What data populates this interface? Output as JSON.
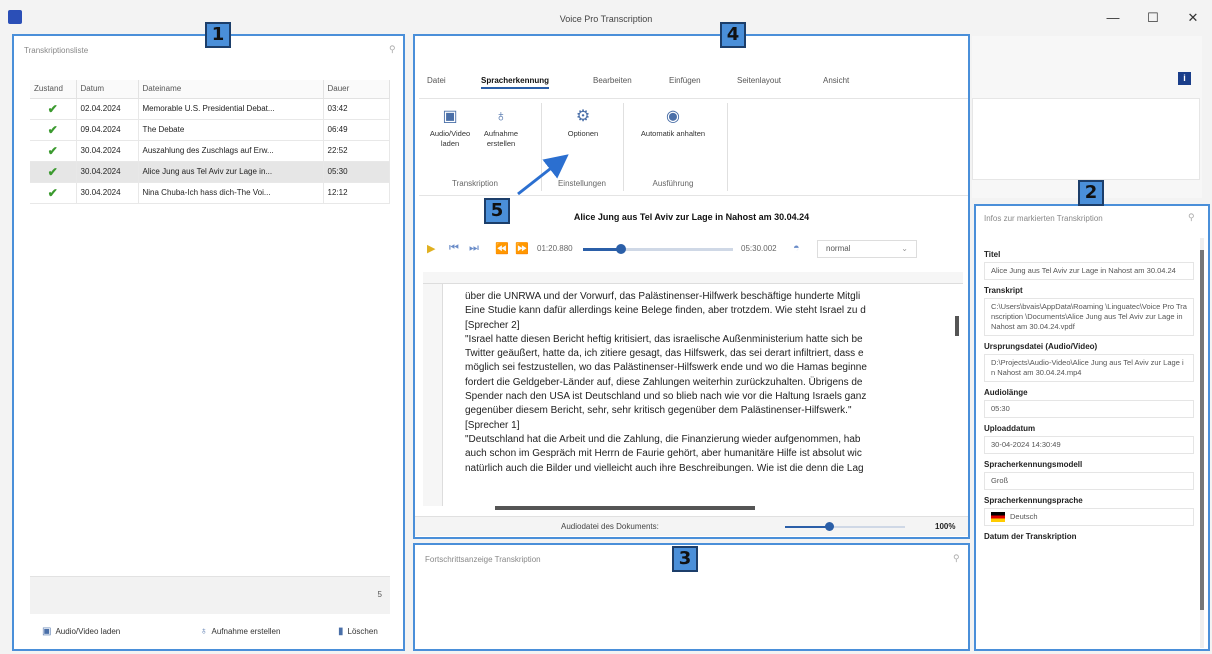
{
  "window": {
    "title": "Voice Pro Transcription",
    "minimize": "—",
    "maximize": "☐",
    "close": "✕"
  },
  "callouts": {
    "n1": "1",
    "n2": "2",
    "n3": "3",
    "n4": "4",
    "n5": "5"
  },
  "list_panel": {
    "title": "Transkriptionsliste",
    "columns": [
      "Zustand",
      "Datum",
      "Dateiname",
      "Dauer"
    ],
    "rows": [
      {
        "date": "02.04.2024",
        "name": "Memorable U.S. Presidential Debat...",
        "dur": "03:42"
      },
      {
        "date": "09.04.2024",
        "name": "The Debate",
        "dur": "06:49"
      },
      {
        "date": "30.04.2024",
        "name": "Auszahlung des Zuschlags auf Erw...",
        "dur": "22:52"
      },
      {
        "date": "30.04.2024",
        "name": "Alice Jung aus Tel Aviv zur Lage in...",
        "dur": "05:30"
      },
      {
        "date": "30.04.2024",
        "name": "Nina Chuba-Ich hass dich-The Voi...",
        "dur": "12:12"
      }
    ],
    "count": "5",
    "buttons": {
      "load": "Audio/Video laden",
      "record": "Aufnahme erstellen",
      "delete": "Löschen"
    }
  },
  "ribbon": {
    "tabs": [
      "Datei",
      "Spracherkennung",
      "Bearbeiten",
      "Einfügen",
      "Seitenlayout",
      "Ansicht"
    ],
    "buttons": {
      "load": "Audio/Video laden",
      "record": "Aufnahme erstellen",
      "options": "Optionen",
      "auto_stop": "Automatik anhalten"
    },
    "groups": {
      "transcription": "Transkription",
      "settings": "Einstellungen",
      "execution": "Ausführung"
    }
  },
  "player": {
    "title": "Alice Jung aus Tel Aviv zur Lage in Nahost am 30.04.24",
    "current_time": "01:20.880",
    "total_time": "05:30.002",
    "speed": "normal",
    "progress": 0.25
  },
  "document": {
    "lines": [
      "über die UNRWA und der Vorwurf, das Palästinenser-Hilfwerk beschäftige hunderte Mitgli",
      "Eine Studie kann dafür allerdings keine Belege finden, aber trotzdem. Wie steht Israel zu d",
      "[Sprecher 2]",
      "\"Israel hatte diesen Bericht heftig kritisiert, das israelische Außenministerium hatte sich be",
      "Twitter geäußert, hatte da, ich zitiere gesagt, das Hilfswerk, das sei derart infiltriert, dass e",
      "möglich sei festzustellen, wo das Palästinenser-Hilfswerk ende und wo die Hamas beginne",
      "fordert die Geldgeber-Länder auf, diese Zahlungen weiterhin zurückzuhalten. Übrigens de",
      "Spender nach den USA ist Deutschland und so blieb nach wie vor die Haltung Israels ganz",
      "gegenüber diesem Bericht, sehr, sehr kritisch gegenüber dem Palästinenser-Hilfswerk.\"",
      "[Sprecher 1]",
      "\"Deutschland hat die Arbeit und die Zahlung, die Finanzierung wieder aufgenommen, hab",
      "auch schon im Gespräch mit Herrn de Faurie gehört, aber humanitäre Hilfe ist absolut wic",
      "natürlich auch die Bilder und vielleicht auch ihre Beschreibungen. Wie ist die denn die Lag"
    ],
    "status_label": "Audiodatei des Dokuments:",
    "zoom": "100%"
  },
  "progress_panel": {
    "title": "Fortschrittsanzeige Transkription"
  },
  "info_panel": {
    "title": "Infos zur markierten Transkription",
    "fields": [
      {
        "label": "Titel",
        "value": "Alice Jung aus Tel Aviv zur Lage in Nahost am 30.04.24"
      },
      {
        "label": "Transkript",
        "value": "C:\\Users\\bvais\\AppData\\Roaming \\Linguatec\\Voice Pro Transcription \\Documents\\Alice Jung aus Tel Aviv zur Lage in Nahost am 30.04.24.vpdf"
      },
      {
        "label": "Ursprungsdatei (Audio/Video)",
        "value": "D:\\Projects\\Audio-Video\\Alice Jung aus Tel Aviv zur Lage in Nahost am 30.04.24.mp4"
      },
      {
        "label": "Audiolänge",
        "value": "05:30"
      },
      {
        "label": "Uploaddatum",
        "value": "30-04-2024 14:30:49"
      },
      {
        "label": "Spracherkennungsmodell",
        "value": "Groß"
      },
      {
        "label": "Spracherkennungsprache",
        "value": "Deutsch"
      },
      {
        "label": "Datum der Transkription",
        "value": ""
      }
    ]
  },
  "colors": {
    "accent_blue": "#4a8fd9",
    "check_green": "#3b9a2f"
  }
}
